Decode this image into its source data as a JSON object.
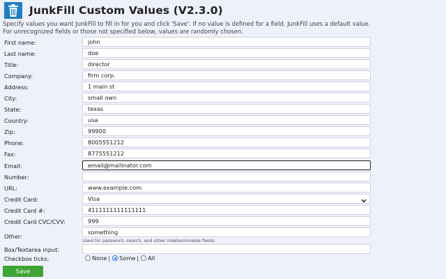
{
  "app": {
    "title": "JunkFill Custom Values (V2.3.0)",
    "logo_icon": "trash-can-logo-icon",
    "accent": "#3ca534"
  },
  "description": {
    "line1": "Specify values you want JunkFill to fill in for you and click 'Save'. If no value is defined for a field, JunkFill uses a default value.",
    "line2": "For unrecognized fields or those not specified below, values are randomly chosen."
  },
  "fields": {
    "first_name": {
      "label": "First name:",
      "value": "john"
    },
    "last_name": {
      "label": "Last name:",
      "value": "doe"
    },
    "title": {
      "label": "Title:",
      "value": "director"
    },
    "company": {
      "label": "Company:",
      "value": "firm corp."
    },
    "address": {
      "label": "Address:",
      "value": "1 main st"
    },
    "city": {
      "label": "City:",
      "value": "small own"
    },
    "state": {
      "label": "State:",
      "value": "texas"
    },
    "country": {
      "label": "Country:",
      "value": "usa"
    },
    "zip": {
      "label": "Zip:",
      "value": "99900"
    },
    "phone": {
      "label": "Phone:",
      "value": "8005551212"
    },
    "fax": {
      "label": "Fax:",
      "value": "8775551212"
    },
    "email": {
      "label": "Email:",
      "value": "email@mailinator.com"
    },
    "number": {
      "label": "Number:",
      "value": ""
    },
    "url": {
      "label": "URL:",
      "value": "www.example.com"
    },
    "credit_card": {
      "label": "Credit Card:",
      "value": "Visa"
    },
    "credit_card_number": {
      "label": "Credit Card #:",
      "value": "4111111111111111"
    },
    "credit_card_cvc": {
      "label": "Credit Card CVC/CVV:",
      "value": "999"
    },
    "other": {
      "label": "Other:",
      "value": "something",
      "hint": "Used for password, search, and other indeterminable fields."
    },
    "textarea": {
      "label": "Box/Textarea input:",
      "value": ""
    }
  },
  "checkbox_ticks": {
    "label": "Checkbox ticks:",
    "options": [
      "None",
      "Some",
      "All"
    ],
    "separator": "|",
    "selected": "Some"
  },
  "save_label": "Save"
}
